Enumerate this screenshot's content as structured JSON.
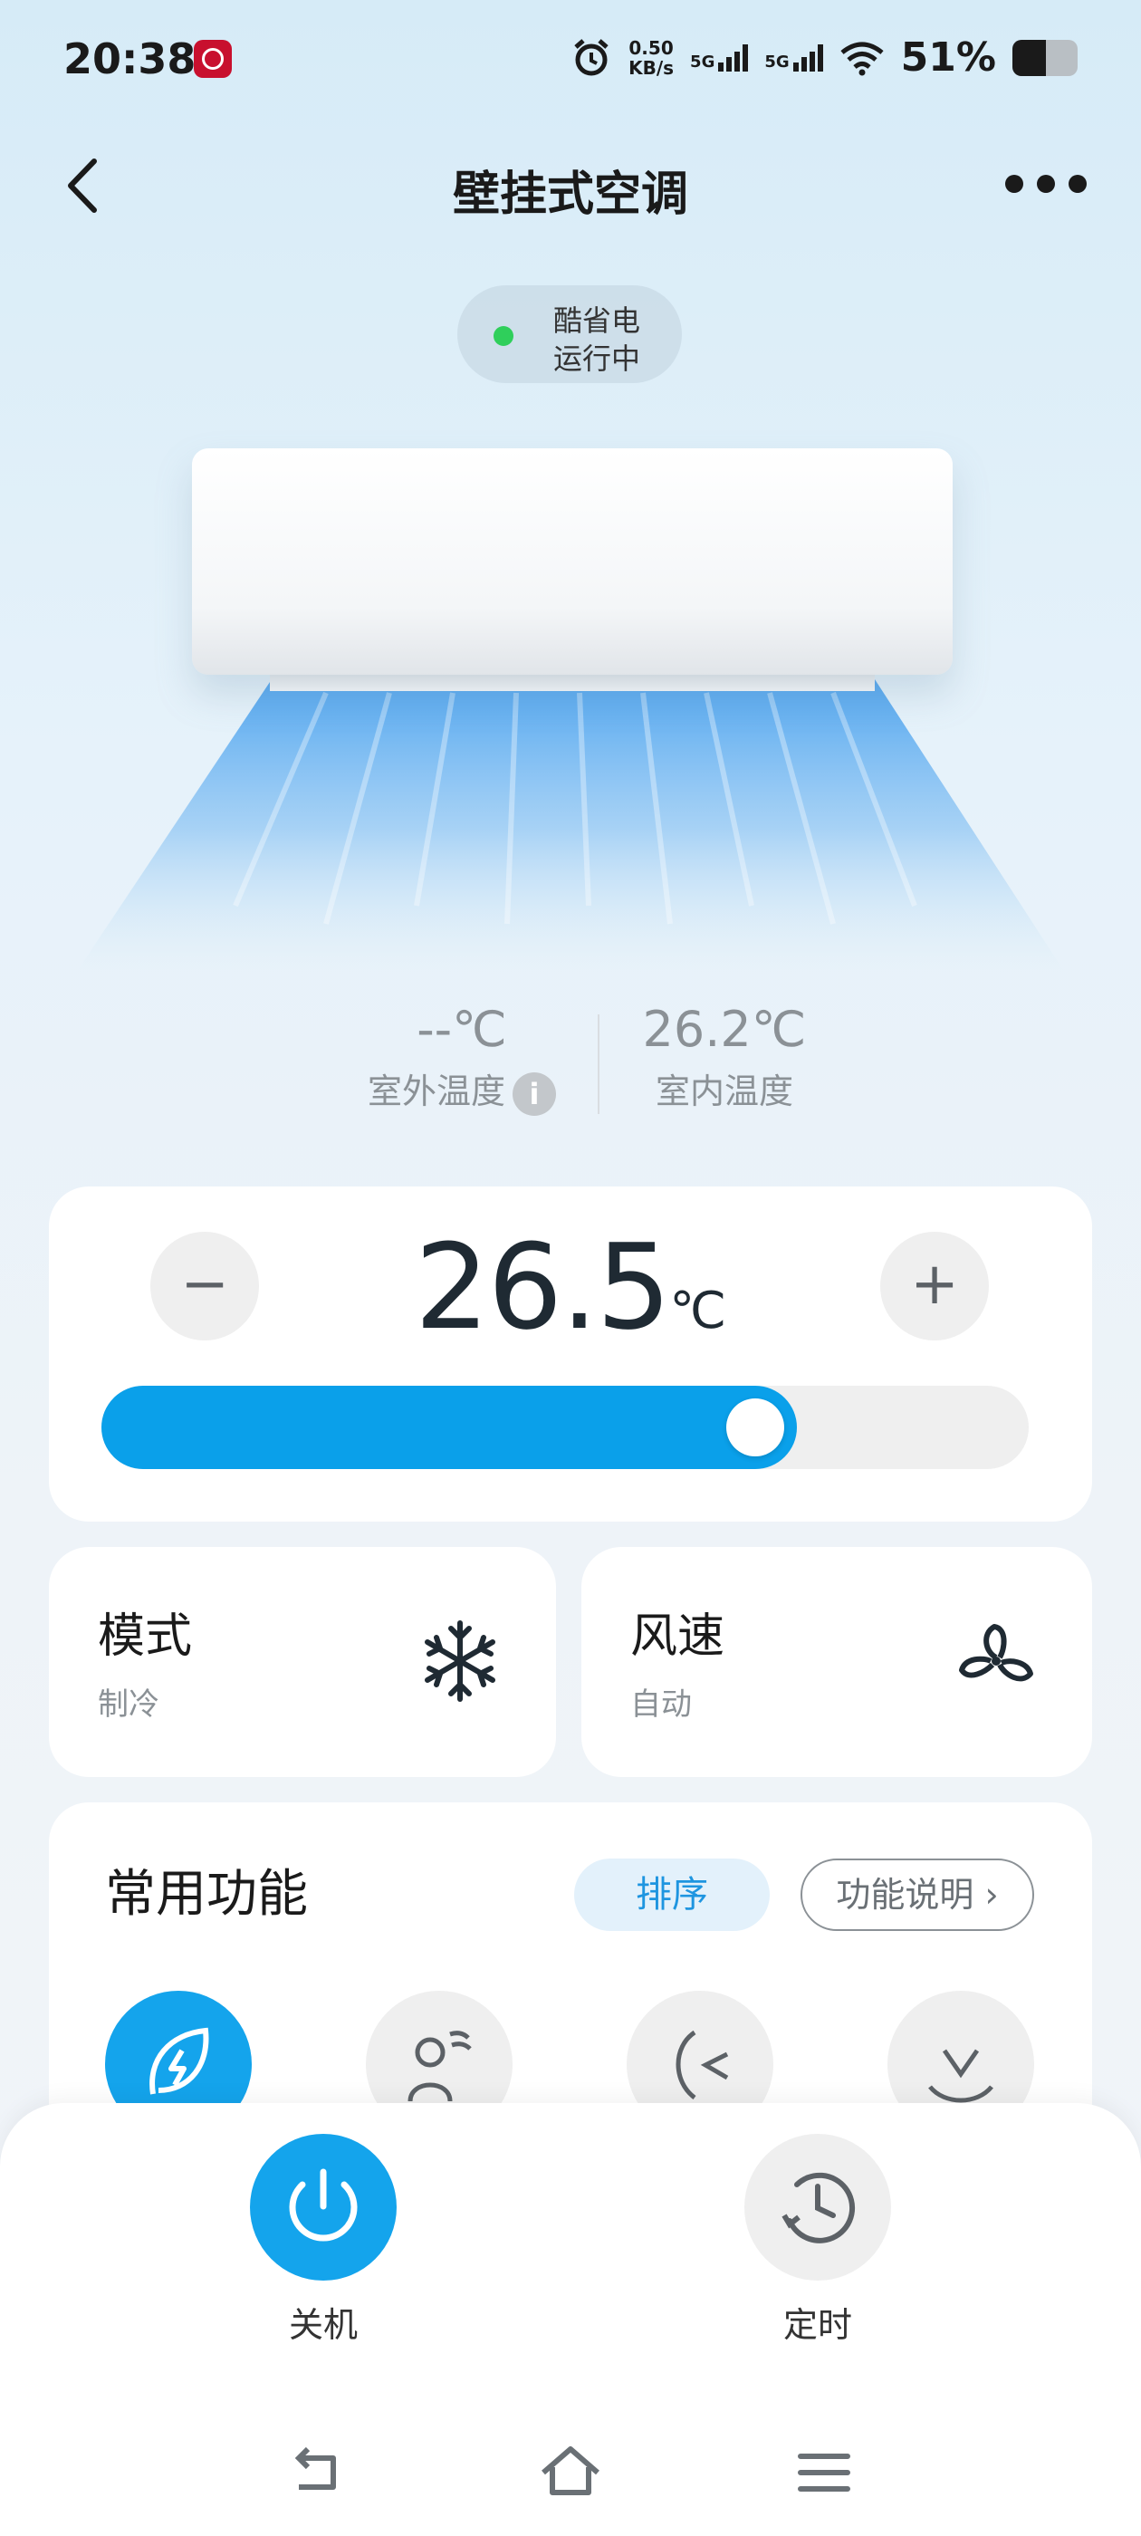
{
  "status_bar": {
    "time": "20:38",
    "net_speed_value": "0.50",
    "net_speed_unit": "KB/s",
    "signal1": "5G",
    "signal2": "5G",
    "battery": "51%"
  },
  "header": {
    "title": "壁挂式空调"
  },
  "device_status": {
    "line1": "酷省电",
    "line2": "运行中",
    "indicator_color": "#2fcf5b"
  },
  "readouts": {
    "outdoor_value": "--℃",
    "outdoor_label": "室外温度",
    "indoor_value": "26.2℃",
    "indoor_label": "室内温度"
  },
  "temperature": {
    "setpoint": "26.5",
    "unit": "℃",
    "minus_label": "−",
    "plus_label": "+",
    "slider_fraction": 0.75
  },
  "mode": {
    "title": "模式",
    "value": "制冷",
    "icon": "snowflake-icon"
  },
  "fan_speed": {
    "title": "风速",
    "value": "自动",
    "icon": "fan-icon"
  },
  "functions": {
    "title": "常用功能",
    "sort_label": "排序",
    "help_label": "功能说明 ›",
    "icons": [
      "eco-leaf-icon",
      "person-wind-icon",
      "swing-left-right-icon",
      "swing-up-down-icon"
    ],
    "active_index": 0
  },
  "bottom_actions": {
    "power_label": "关机",
    "timer_label": "定时"
  },
  "colors": {
    "accent": "#14a4ec",
    "slider": "#0aa0ea"
  }
}
